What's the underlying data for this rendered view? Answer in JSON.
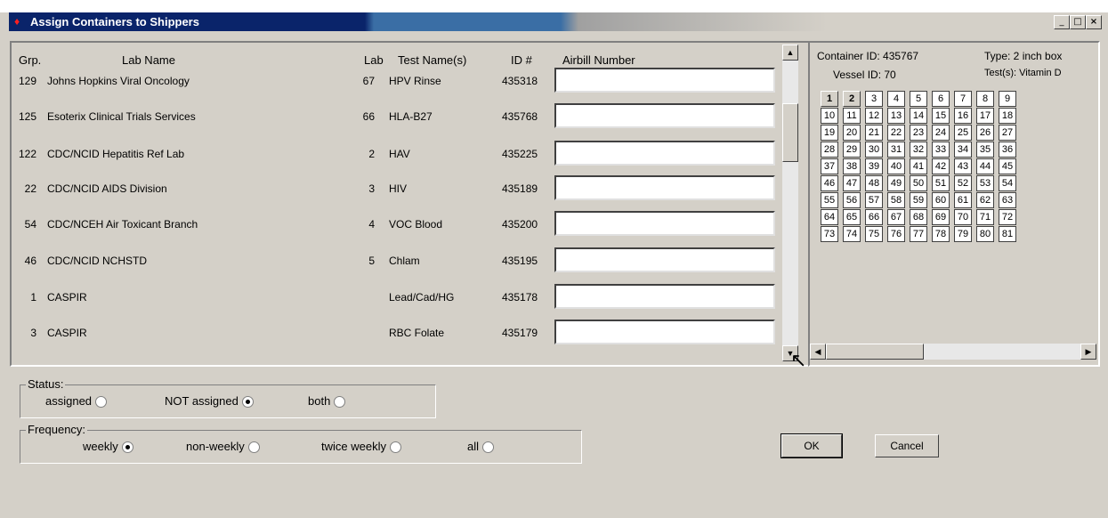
{
  "window": {
    "title": "Assign Containers to Shippers"
  },
  "columns": {
    "grp": "Grp.",
    "lab_name": "Lab Name",
    "lab": "Lab",
    "test": "Test Name(s)",
    "id": "ID #",
    "airbill": "Airbill Number"
  },
  "rows": [
    {
      "grp": "129",
      "name": "Johns Hopkins Viral Oncology",
      "lab": "67",
      "test": "HPV Rinse",
      "id": "435318",
      "airbill": ""
    },
    {
      "grp": "125",
      "name": "Esoterix Clinical Trials Services",
      "lab": "66",
      "test": "HLA-B27",
      "id": "435768",
      "airbill": ""
    },
    {
      "grp": "122",
      "name": "CDC/NCID Hepatitis Ref Lab",
      "lab": "2",
      "test": "HAV",
      "id": "435225",
      "airbill": ""
    },
    {
      "grp": "22",
      "name": "CDC/NCID AIDS Division",
      "lab": "3",
      "test": "HIV",
      "id": "435189",
      "airbill": ""
    },
    {
      "grp": "54",
      "name": "CDC/NCEH Air Toxicant Branch",
      "lab": "4",
      "test": "VOC Blood",
      "id": "435200",
      "airbill": ""
    },
    {
      "grp": "46",
      "name": "CDC/NCID NCHSTD",
      "lab": "5",
      "test": "Chlam",
      "id": "435195",
      "airbill": ""
    },
    {
      "grp": "1",
      "name": "CASPIR",
      "lab": "",
      "test": "Lead/Cad/HG",
      "id": "435178",
      "airbill": ""
    },
    {
      "grp": "3",
      "name": "CASPIR",
      "lab": "",
      "test": "RBC Folate",
      "id": "435179",
      "airbill": ""
    }
  ],
  "container": {
    "id_label": "Container ID: 435767",
    "type_label": "Type: 2 inch box",
    "vessel_label": "Vessel ID: 70",
    "tests_label": "Test(s): Vitamin D",
    "grid": [
      "1",
      "2",
      "3",
      "4",
      "5",
      "6",
      "7",
      "8",
      "9",
      "10",
      "11",
      "12",
      "13",
      "14",
      "15",
      "16",
      "17",
      "18",
      "19",
      "20",
      "21",
      "22",
      "23",
      "24",
      "25",
      "26",
      "27",
      "28",
      "29",
      "30",
      "31",
      "32",
      "33",
      "34",
      "35",
      "36",
      "37",
      "38",
      "39",
      "40",
      "41",
      "42",
      "43",
      "44",
      "45",
      "46",
      "47",
      "48",
      "49",
      "50",
      "51",
      "52",
      "53",
      "54",
      "55",
      "56",
      "57",
      "58",
      "59",
      "60",
      "61",
      "62",
      "63",
      "64",
      "65",
      "66",
      "67",
      "68",
      "69",
      "70",
      "71",
      "72",
      "73",
      "74",
      "75",
      "76",
      "77",
      "78",
      "79",
      "80",
      "81"
    ],
    "selected": [
      "1",
      "2"
    ]
  },
  "status": {
    "label": "Status:",
    "options": [
      {
        "label": "assigned",
        "checked": false
      },
      {
        "label": "NOT assigned",
        "checked": true
      },
      {
        "label": "both",
        "checked": false
      }
    ]
  },
  "frequency": {
    "label": "Frequency:",
    "options": [
      {
        "label": "weekly",
        "checked": true
      },
      {
        "label": "non-weekly",
        "checked": false
      },
      {
        "label": "twice weekly",
        "checked": false
      },
      {
        "label": "all",
        "checked": false
      }
    ]
  },
  "buttons": {
    "ok": "OK",
    "cancel": "Cancel"
  },
  "icons": {
    "app": "app-icon",
    "minimize": "minimize-icon",
    "maximize": "maximize-icon",
    "close": "close-icon"
  }
}
